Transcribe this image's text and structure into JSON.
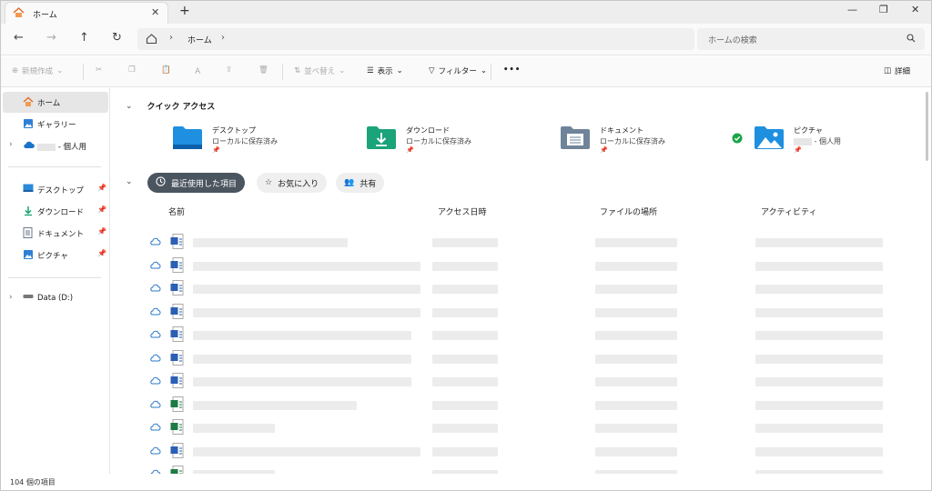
{
  "tab": {
    "title": "ホーム"
  },
  "address": {
    "crumb": "ホーム"
  },
  "search": {
    "placeholder": "ホームの検索"
  },
  "commands": {
    "new": "新規作成",
    "sort": "並べ替え",
    "view": "表示",
    "filter": "フィルター",
    "details": "詳細"
  },
  "sidebar": {
    "home": "ホーム",
    "gallery": "ギャラリー",
    "onedrive": "- 個人用",
    "desktop": "デスクトップ",
    "downloads": "ダウンロード",
    "documents": "ドキュメント",
    "pictures": "ピクチャ",
    "drive": "Data (D:)"
  },
  "quick_access": {
    "header": "クイック アクセス",
    "items": [
      {
        "name": "デスクトップ",
        "sub": "ローカルに保存済み"
      },
      {
        "name": "ダウンロード",
        "sub": "ローカルに保存済み"
      },
      {
        "name": "ドキュメント",
        "sub": "ローカルに保存済み"
      },
      {
        "name": "ピクチャ",
        "sub": "- 個人用"
      }
    ]
  },
  "filters": {
    "recent": "最近使用した項目",
    "favorites": "お気に入り",
    "shared": "共有"
  },
  "columns": {
    "name": "名前",
    "access": "アクセス日時",
    "location": "ファイルの場所",
    "activity": "アクティビティ"
  },
  "status": {
    "count": "104 個の項目"
  },
  "colors": {
    "accent": "#4b5560",
    "folder_blue": "#1f8fe0",
    "folder_green": "#1ba37a",
    "check_green": "#1aa548"
  },
  "file_types": [
    "word",
    "word",
    "word",
    "word",
    "word",
    "word",
    "word",
    "excel",
    "excel",
    "word",
    "excel"
  ]
}
